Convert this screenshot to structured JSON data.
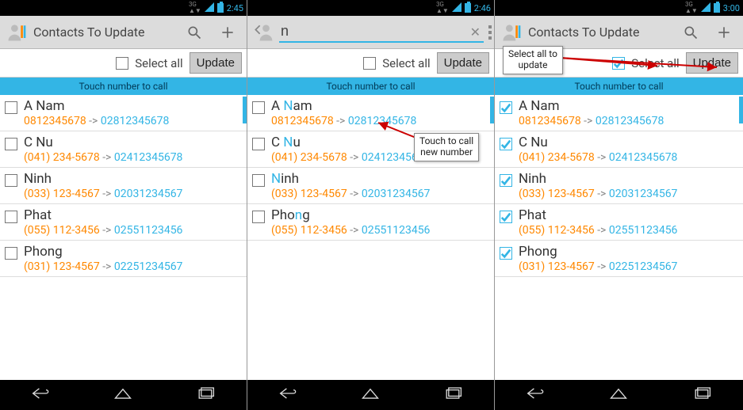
{
  "screens": [
    {
      "time": "2:45",
      "title": "Contacts To Update",
      "mode": "normal",
      "select_all_label": "Select all",
      "select_all_checked": false,
      "update_label": "Update",
      "banner": "Touch number to call",
      "contacts": [
        {
          "checked": false,
          "name_pre": "",
          "name_hl": "",
          "name_post": "A Nam",
          "old": "0812345678",
          "new": "02812345678"
        },
        {
          "checked": false,
          "name_pre": "",
          "name_hl": "",
          "name_post": "C Nu",
          "old": "(041) 234-5678",
          "new": "02412345678"
        },
        {
          "checked": false,
          "name_pre": "",
          "name_hl": "",
          "name_post": "Ninh",
          "old": "(033) 123-4567",
          "new": "02031234567"
        },
        {
          "checked": false,
          "name_pre": "",
          "name_hl": "",
          "name_post": "Phat",
          "old": "(055) 112-3456",
          "new": "02551123456"
        },
        {
          "checked": false,
          "name_pre": "",
          "name_hl": "",
          "name_post": "Phong",
          "old": "(031) 123-4567",
          "new": "02251234567"
        }
      ]
    },
    {
      "time": "2:46",
      "mode": "search",
      "search_value": "n",
      "select_all_label": "Select all",
      "select_all_checked": false,
      "update_label": "Update",
      "banner": "Touch number to call",
      "callout": "Touch to call\nnew number",
      "contacts": [
        {
          "checked": false,
          "name_pre": "A ",
          "name_hl": "N",
          "name_post": "am",
          "old": "0812345678",
          "new": "02812345678"
        },
        {
          "checked": false,
          "name_pre": "C ",
          "name_hl": "N",
          "name_post": "u",
          "old": "(041) 234-5678",
          "new": "02412345678"
        },
        {
          "checked": false,
          "name_pre": "",
          "name_hl": "N",
          "name_post": "inh",
          "old": "(033) 123-4567",
          "new": "02031234567"
        },
        {
          "checked": false,
          "name_pre": "Pho",
          "name_hl": "n",
          "name_post": "g",
          "old": "(055) 112-3456",
          "new": "02551123456"
        }
      ]
    },
    {
      "time": "3:00",
      "title": "Contacts To Update",
      "mode": "normal",
      "select_all_label": "Select all",
      "select_all_checked": true,
      "update_label": "Update",
      "banner": "Touch number to call",
      "callout": "Select all to\nupdate",
      "contacts": [
        {
          "checked": true,
          "name_pre": "",
          "name_hl": "",
          "name_post": "A Nam",
          "old": "0812345678",
          "new": "02812345678"
        },
        {
          "checked": true,
          "name_pre": "",
          "name_hl": "",
          "name_post": "C Nu",
          "old": "(041) 234-5678",
          "new": "02412345678"
        },
        {
          "checked": true,
          "name_pre": "",
          "name_hl": "",
          "name_post": "Ninh",
          "old": "(033) 123-4567",
          "new": "02031234567"
        },
        {
          "checked": true,
          "name_pre": "",
          "name_hl": "",
          "name_post": "Phat",
          "old": "(055) 112-3456",
          "new": "02551123456"
        },
        {
          "checked": true,
          "name_pre": "",
          "name_hl": "",
          "name_post": "Phong",
          "old": "(031) 123-4567",
          "new": "02251234567"
        }
      ]
    }
  ]
}
